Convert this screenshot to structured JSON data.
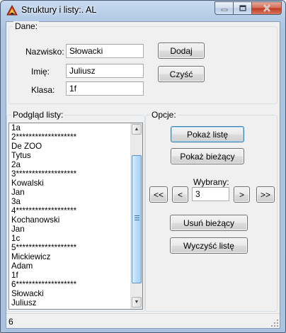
{
  "window": {
    "title": "Struktury i listy:. AL",
    "controls": [
      "minimize-icon",
      "maximize-icon",
      "close-icon"
    ]
  },
  "dane": {
    "group_label": "Dane:",
    "nazwisko_label": "Nazwisko:",
    "nazwisko_value": "Słowacki",
    "imie_label": "Imię:",
    "imie_value": "Juliusz",
    "klasa_label": "Klasa:",
    "klasa_value": "1f",
    "dodaj_button": "Dodaj",
    "czysc_button": "Czyść"
  },
  "podglad": {
    "group_label": "Podgląd listy:",
    "items": [
      "1a",
      "2*******************",
      "De ZOO",
      "Tytus",
      "2a",
      "3*******************",
      "Kowalski",
      "Jan",
      "3a",
      "4*******************",
      "Kochanowski",
      "Jan",
      "1c",
      "5*******************",
      "Mickiewicz",
      "Adam",
      "1f",
      "6*******************",
      "Słowacki",
      "Juliusz"
    ]
  },
  "opcje": {
    "group_label": "Opcje:",
    "pokaz_liste_button": "Pokaż listę",
    "pokaz_biezacy_button": "Pokaż bieżący",
    "wybrany_label": "Wybrany:",
    "wybrany_value": "3",
    "first_button": "<<",
    "prev_button": "<",
    "next_button": ">",
    "last_button": ">>",
    "usun_biezacy_button": "Usuń bieżący",
    "wyczysc_liste_button": "Wyczyść listę"
  },
  "status": {
    "count": "6"
  }
}
